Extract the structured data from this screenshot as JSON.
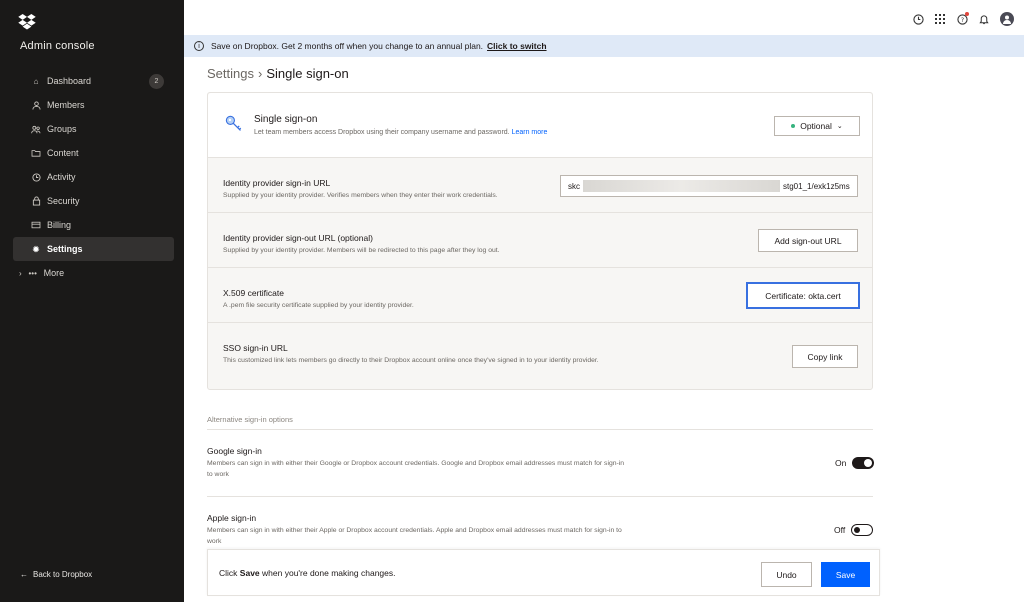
{
  "sidebar": {
    "brand": "Admin console",
    "items": [
      {
        "label": "Dashboard",
        "icon": "home-icon",
        "badge": "2"
      },
      {
        "label": "Members",
        "icon": "person-icon"
      },
      {
        "label": "Groups",
        "icon": "groups-icon"
      },
      {
        "label": "Content",
        "icon": "folder-icon"
      },
      {
        "label": "Activity",
        "icon": "clock-icon"
      },
      {
        "label": "Security",
        "icon": "lock-icon"
      },
      {
        "label": "Billing",
        "icon": "card-icon"
      },
      {
        "label": "Settings",
        "icon": "gear-icon",
        "active": true
      }
    ],
    "more": "More",
    "back": "Back to Dropbox"
  },
  "banner": {
    "text": "Save on Dropbox. Get 2 months off when you change to an annual plan.",
    "link": "Click to switch"
  },
  "breadcrumb": {
    "parent": "Settings",
    "separator": "›",
    "current": "Single sign-on"
  },
  "sso": {
    "title": "Single sign-on",
    "description": "Let team members access Dropbox using their company username and password.",
    "learn_more": "Learn more",
    "status": "Optional"
  },
  "rows": {
    "signin_url": {
      "title": "Identity provider sign-in URL",
      "description": "Supplied by your identity provider. Verifies members when they enter their work credentials.",
      "value_prefix": "skc",
      "value_suffix": "stg01_1/exk1z5ms"
    },
    "signout_url": {
      "title": "Identity provider sign-out URL (optional)",
      "description": "Supplied by your identity provider. Members will be redirected to this page after they log out.",
      "button": "Add sign-out URL"
    },
    "certificate": {
      "title": "X.509 certificate",
      "description": "A .pem file security certificate supplied by your identity provider.",
      "button": "Certificate: okta.cert"
    },
    "sso_url": {
      "title": "SSO sign-in URL",
      "description": "This customized link lets members go directly to their Dropbox account online once they've signed in to your identity provider.",
      "button": "Copy link"
    }
  },
  "alternative": {
    "heading": "Alternative sign-in options",
    "google": {
      "title": "Google sign-in",
      "description": "Members can sign in with either their Google or Dropbox account credentials. Google and Dropbox email addresses must match for sign-in to work",
      "state": "On"
    },
    "apple": {
      "title": "Apple sign-in",
      "description": "Members can sign in with either their Apple or Dropbox account credentials. Apple and Dropbox email addresses must match for sign-in to work",
      "state": "Off"
    }
  },
  "savebar": {
    "prefix": "Click",
    "bold": "Save",
    "suffix": "when you're done making changes.",
    "undo": "Undo",
    "save": "Save"
  },
  "colors": {
    "sidebar_bg": "#1a1918",
    "accent": "#0061fe",
    "banner_bg": "#dfe9f7",
    "focus": "#3870e0"
  }
}
